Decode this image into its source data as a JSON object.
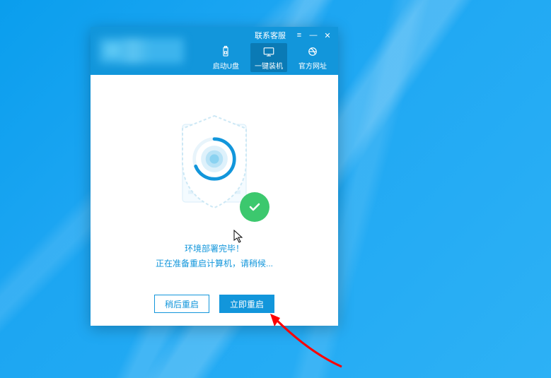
{
  "titlebar": {
    "contact_label": "联系客服"
  },
  "tabs": {
    "usb": "启动U盘",
    "install": "一键装机",
    "website": "官方网址"
  },
  "status": {
    "line1": "环境部署完毕！",
    "line2": "正在准备重启计算机，请稍候..."
  },
  "buttons": {
    "later": "稍后重启",
    "now": "立即重启"
  },
  "colors": {
    "primary": "#1296db",
    "success": "#3cc86e"
  }
}
